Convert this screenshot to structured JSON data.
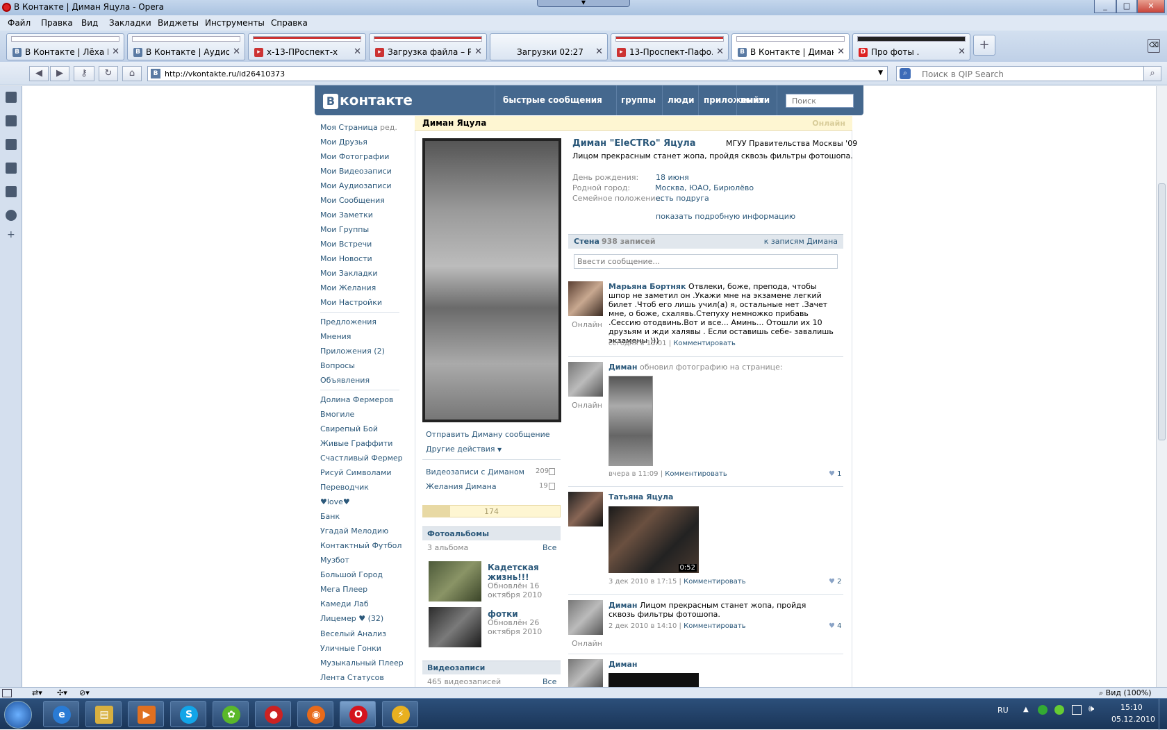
{
  "window": {
    "title": "В Контакте | Диман Яцула - Opera"
  },
  "menu": [
    "Файл",
    "Правка",
    "Вид",
    "Закладки",
    "Виджеты",
    "Инструменты",
    "Справка"
  ],
  "tabs": [
    {
      "label": "В Контакте | Лёха М...",
      "fav": "B"
    },
    {
      "label": "В Контакте | Аудио",
      "fav": "B"
    },
    {
      "label": "x-13-ПРоспект-x",
      "fav": "▸"
    },
    {
      "label": "Загрузка файла – Р...",
      "fav": "▸"
    },
    {
      "label": "Загрузки 02:27",
      "fav": ""
    },
    {
      "label": "13-Проспект-Пафо...",
      "fav": "▸"
    },
    {
      "label": "В Контакте | Диман ...",
      "fav": "B"
    },
    {
      "label": "Про фоты .",
      "fav": "D"
    }
  ],
  "address": {
    "url": "http://vkontakte.ru/id26410373",
    "search_placeholder": "Поиск в QIP Search"
  },
  "vk": {
    "logo": "контакте",
    "logo_letter": "B",
    "nav": [
      "быстрые сообщения",
      "группы",
      "люди",
      "приложения",
      "выйти"
    ],
    "search_placeholder": "Поиск",
    "left_menu": [
      "Моя Страница",
      "Мои Друзья",
      "Мои Фотографии",
      "Мои Видеозаписи",
      "Мои Аудиозаписи",
      "Мои Сообщения",
      "Мои Заметки",
      "Мои Группы",
      "Мои Встречи",
      "Мои Новости",
      "Мои Закладки",
      "Мои Желания",
      "Мои Настройки"
    ],
    "edit_label": "ред.",
    "left_menu2": [
      "Предложения",
      "Мнения",
      "Приложения (2)",
      "Вопросы",
      "Объявления"
    ],
    "apps": [
      "Долина Фермеров",
      "Вмогиле",
      "Свирепый Бой",
      "Живые Граффити",
      "Счастливый Фермер",
      "Рисуй Символами",
      "Переводчик",
      "♥love♥",
      "Банк",
      "Угадай Мелодию",
      "Контактный Футбол",
      "Музбот",
      "Большой Город",
      "Мега Плеер",
      "Камеди Лаб",
      "Лицемер ♥ (32)",
      "Веселый Анализ",
      "Уличные Гонки",
      "Музыкальный Плеер",
      "Лента Статусов"
    ],
    "owner_name": "Диман Яцула",
    "online": "Онлайн",
    "profile": {
      "full_name": "Диман \"EleCTRo\" Яцула",
      "university": "МГУУ Правительства Москвы '09",
      "status": "Лицом прекрасным станет жопа, пройдя сквозь фильтры фотошопа.",
      "fields": [
        {
          "label": "День рождения:",
          "value": "18 июня"
        },
        {
          "label": "Родной город:",
          "value": "Москва, ЮАО, Бирюлёво"
        },
        {
          "label": "Семейное положение:",
          "value": "есть подруга"
        }
      ],
      "more": "показать подробную информацию"
    },
    "actions": {
      "send": "Отправить Диману сообщение",
      "other": "Другие действия"
    },
    "counts": [
      {
        "label": "Видеозаписи с Диманом",
        "count": "209"
      },
      {
        "label": "Желания Димана",
        "count": "19"
      }
    ],
    "rating": "174",
    "albums": {
      "title": "Фотоальбомы",
      "count": "3 альбома",
      "all": "Все",
      "items": [
        {
          "name": "Кадетская жизнь!!!",
          "updated": "Обновлён 16 октября 2010"
        },
        {
          "name": "фотки",
          "updated": "Обновлён 26 октября 2010"
        }
      ]
    },
    "videos": {
      "title": "Видеозаписи",
      "count": "465 видеозаписей",
      "all": "Все"
    },
    "wall": {
      "title": "Стена",
      "count": "938 записей",
      "to_posts": "к записям Димана",
      "input_placeholder": "Ввести сообщение...",
      "posts": [
        {
          "author": "Марьяна Бортняк",
          "text": "Отвлеки, боже, препода, чтобы шпор не заметил он .Укажи мне на экзамене легкий билет .Чтоб его лишь учил(а) я, остальные нет .Зачет мне, о боже, схалявь.Степуху немножко прибавь .Сессию отодвинь.Вот и все... Аминь... Отошли их 10 друзьям и жди халявы . Если оставишь себе- завалишь экзамены )))",
          "date": "сегодня в 15:01",
          "comment": "Комментировать",
          "online": "Онлайн",
          "likes": ""
        },
        {
          "author": "Диман",
          "text": "обновил фотографию на странице:",
          "date": "вчера в 11:09",
          "comment": "Комментировать",
          "online": "Онлайн",
          "likes": "1"
        },
        {
          "author": "Татьяна Яцула",
          "text": "",
          "date": "3 дек 2010 в 17:15",
          "comment": "Комментировать",
          "online": "",
          "likes": "2",
          "video_time": "0:52"
        },
        {
          "author": "Диман",
          "text": "Лицом прекрасным станет жопа, пройдя сквозь фильтры фотошопа.",
          "date": "2 дек 2010 в 14:10",
          "comment": "Комментировать",
          "online": "Онлайн",
          "likes": "4"
        },
        {
          "author": "Диман",
          "text": "",
          "date": "",
          "comment": "",
          "online": "",
          "likes": ""
        }
      ]
    }
  },
  "statusbar": {
    "zoom": "Вид (100%)"
  },
  "taskbar": {
    "lang": "RU",
    "time": "15:10",
    "date": "05.12.2010"
  }
}
